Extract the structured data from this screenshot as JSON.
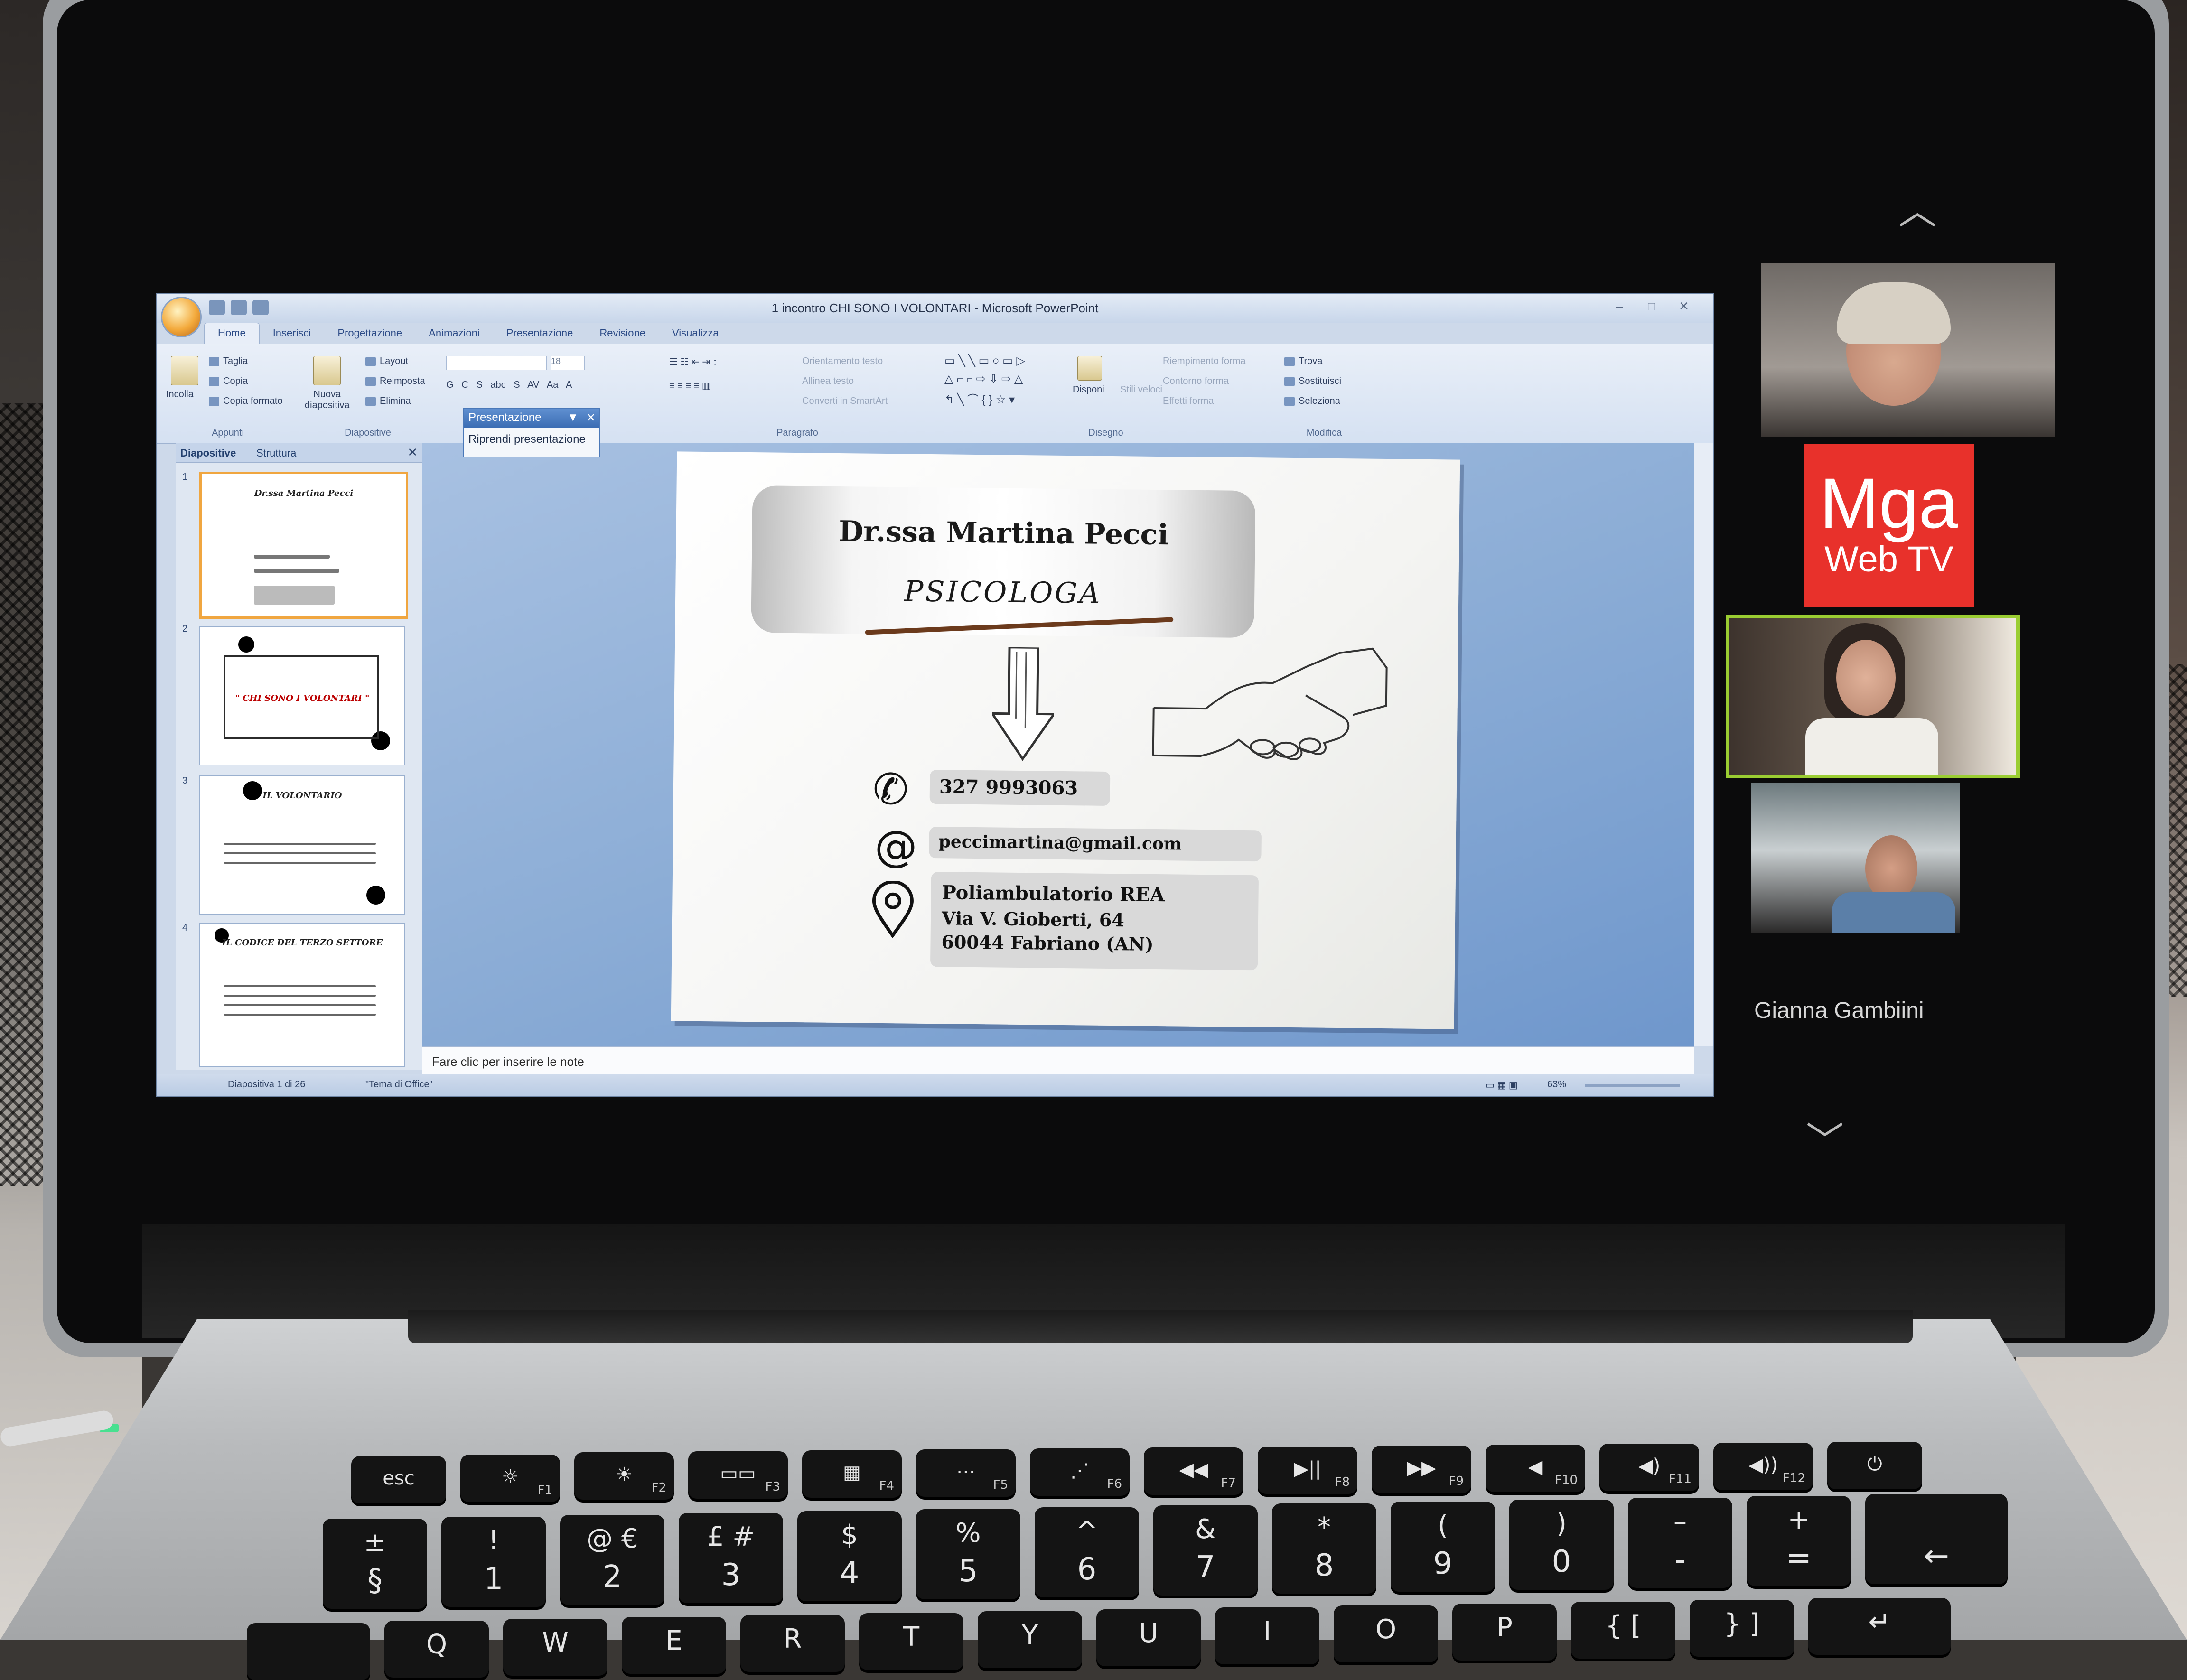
{
  "window": {
    "title": "1 incontro CHI SONO I VOLONTARI - Microsoft PowerPoint",
    "min": "–",
    "max": "□",
    "close": "✕"
  },
  "ribbon_tabs": [
    "Home",
    "Inserisci",
    "Progettazione",
    "Animazioni",
    "Presentazione",
    "Revisione",
    "Visualizza"
  ],
  "ribbon": {
    "clipboard": {
      "paste": "Incolla",
      "cut": "Taglia",
      "copy": "Copia",
      "format_painter": "Copia formato",
      "group": "Appunti"
    },
    "slides": {
      "new_slide_line1": "Nuova",
      "new_slide_line2": "diapositiva",
      "layout": "Layout",
      "reset": "Reimposta",
      "delete": "Elimina",
      "group": "Diapositive"
    },
    "paragraph": {
      "text_direction": "Orientamento testo",
      "align_text": "Allinea testo",
      "smartart": "Converti in SmartArt",
      "group": "Paragrafo"
    },
    "drawing": {
      "arrange": "Disponi",
      "quick_styles": "Stili veloci",
      "fill": "Riempimento forma",
      "outline": "Contorno forma",
      "effects": "Effetti forma",
      "group": "Disegno"
    },
    "editing": {
      "find": "Trova",
      "replace": "Sostituisci",
      "select": "Seleziona",
      "group": "Modifica"
    },
    "font_size": "18"
  },
  "popup": {
    "title": "Presentazione",
    "item": "Riprendi presentazione"
  },
  "left_pane": {
    "tabs": [
      "Diapositive",
      "Struttura"
    ],
    "thumbnails": [
      {
        "num": "1",
        "title": "Dr.ssa Martina Pecci"
      },
      {
        "num": "2",
        "title": "\" CHI SONO I VOLONTARI \""
      },
      {
        "num": "3",
        "title": "IL VOLONTARIO"
      },
      {
        "num": "4",
        "title": "IL CODICE DEL TERZO SETTORE"
      }
    ]
  },
  "slide": {
    "name": "Dr.ssa Martina Pecci",
    "role": "PSICOLOGA",
    "phone": "327 9993063",
    "email": "peccimartina@gmail.com",
    "address_line1": "Poliambulatorio REA",
    "address_line2": "Via V. Gioberti, 64",
    "address_line3": "60044 Fabriano (AN)"
  },
  "notes_placeholder": "Fare clic per inserire le note",
  "status": {
    "slide_info": "Diapositiva 1 di 26",
    "theme": "\"Tema di Office\"",
    "zoom": "63%"
  },
  "participants": {
    "brand_line1": "Mga",
    "brand_line2": "Web TV",
    "name": "Gianna Gambiini",
    "active_border": "#9acd32"
  },
  "keyboard": {
    "fkeys": [
      {
        "label": "esc",
        "fn": ""
      },
      {
        "label": "☼",
        "fn": "F1"
      },
      {
        "label": "☀",
        "fn": "F2"
      },
      {
        "label": "▭▭",
        "fn": "F3"
      },
      {
        "label": "▦",
        "fn": "F4"
      },
      {
        "label": "⋯",
        "fn": "F5"
      },
      {
        "label": "⋰",
        "fn": "F6"
      },
      {
        "label": "◀◀",
        "fn": "F7"
      },
      {
        "label": "▶||",
        "fn": "F8"
      },
      {
        "label": "▶▶",
        "fn": "F9"
      },
      {
        "label": "◀",
        "fn": "F10"
      },
      {
        "label": "◀)",
        "fn": "F11"
      },
      {
        "label": "◀))",
        "fn": "F12"
      },
      {
        "label": "⏻",
        "fn": ""
      }
    ],
    "num_row": [
      {
        "top": "±",
        "bottom": "§"
      },
      {
        "top": "!",
        "bottom": "1"
      },
      {
        "top": "@ €",
        "bottom": "2"
      },
      {
        "top": "£ #",
        "bottom": "3"
      },
      {
        "top": "$",
        "bottom": "4"
      },
      {
        "top": "%",
        "bottom": "5"
      },
      {
        "top": "^",
        "bottom": "6"
      },
      {
        "top": "&",
        "bottom": "7"
      },
      {
        "top": "*",
        "bottom": "8"
      },
      {
        "top": "(",
        "bottom": "9"
      },
      {
        "top": ")",
        "bottom": "0"
      },
      {
        "top": "–",
        "bottom": "-"
      },
      {
        "top": "+",
        "bottom": "="
      },
      {
        "top": "",
        "bottom": "←"
      }
    ],
    "letter_row": [
      "Q",
      "W",
      "E",
      "R",
      "T",
      "Y",
      "U",
      "I",
      "O",
      "P",
      "{ [",
      "} ]",
      "↵"
    ]
  }
}
